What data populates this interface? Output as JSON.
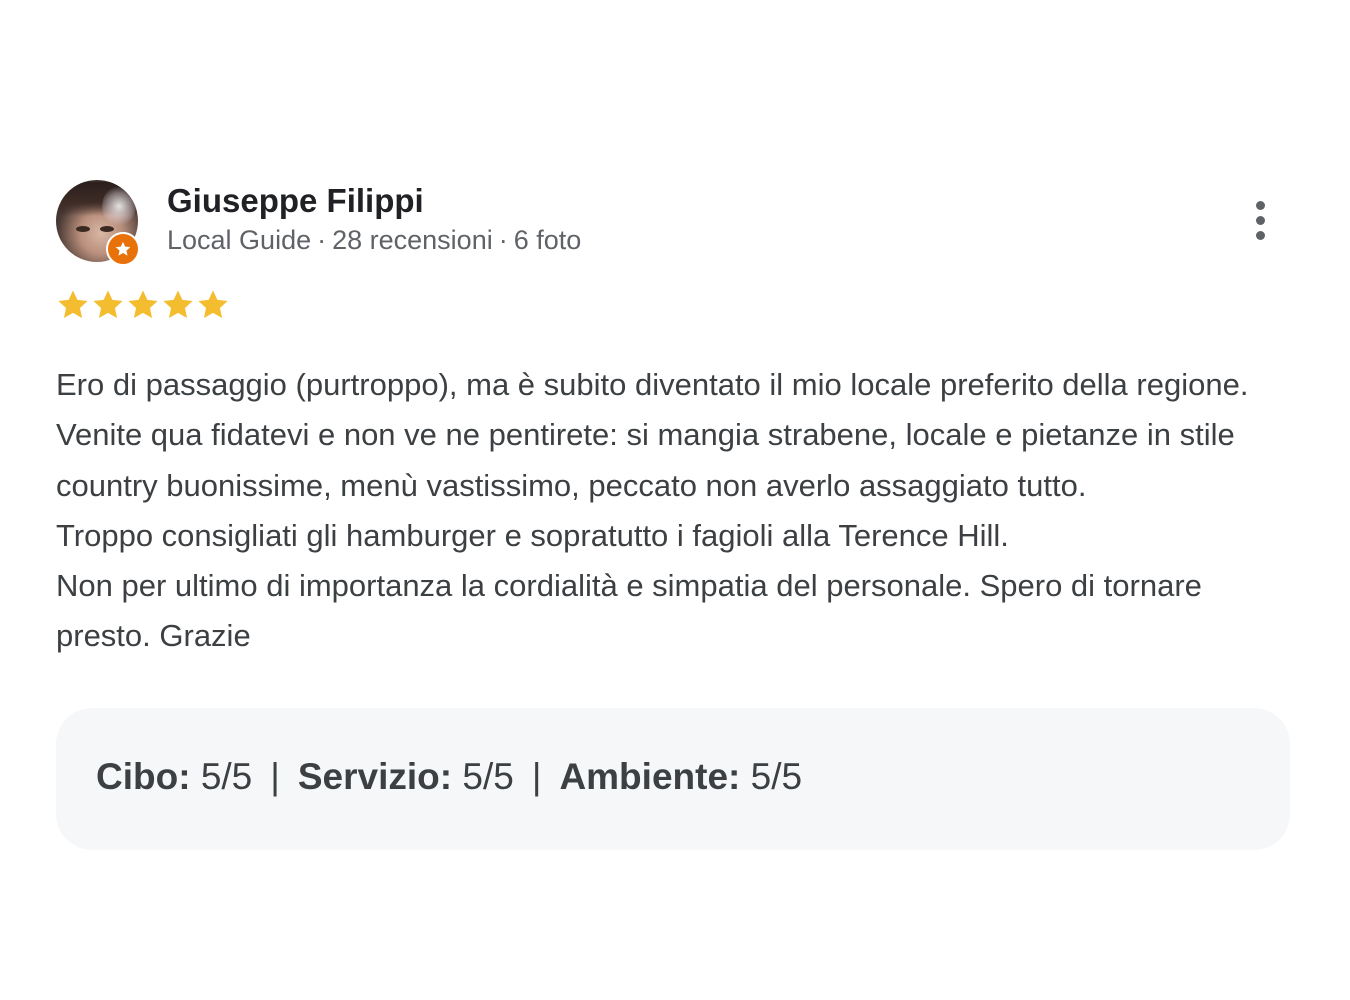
{
  "reviewer": {
    "name": "Giuseppe Filippi",
    "level": "Local Guide",
    "reviews_count": "28 recensioni",
    "photos_count": "6 foto",
    "separator": "·",
    "badge_icon": "star-icon",
    "badge_color": "#e8710a"
  },
  "more_options_icon": "more-vert-icon",
  "rating": {
    "stars": 5,
    "max_stars": 5,
    "star_color": "#f4bd2f"
  },
  "review": {
    "paragraphs": [
      "Ero di passaggio (purtroppo), ma è subito diventato il mio locale preferito della regione. Venite qua fidatevi e non ve ne pentirete: si mangia strabene, locale e pietanze in stile country buonissime, menù vastissimo, peccato non averlo assaggiato tutto.",
      "Troppo consigliati gli hamburger e sopratutto i fagioli alla Terence Hill.",
      "Non per ultimo di importanza la cordialità e simpatia del personale. Spero di tornare presto. Grazie"
    ]
  },
  "sub_ratings": {
    "separator": "|",
    "items": [
      {
        "label": "Cibo:",
        "value": "5/5"
      },
      {
        "label": "Servizio:",
        "value": "5/5"
      },
      {
        "label": "Ambiente:",
        "value": "5/5"
      }
    ]
  }
}
